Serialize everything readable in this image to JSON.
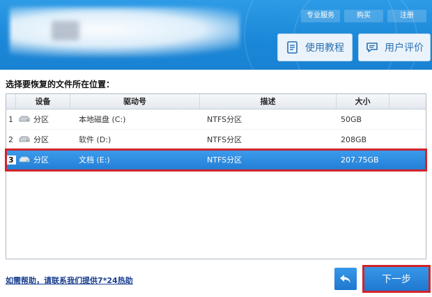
{
  "header": {
    "top_links": [
      "专业服务",
      "购买",
      "注册"
    ],
    "tutorial_label": "使用教程",
    "reviews_label": "用户评价"
  },
  "instruction": "选择要恢复的文件所在位置：",
  "table": {
    "columns": [
      "",
      "设备",
      "驱动号",
      "描述",
      "大小"
    ],
    "rows": [
      {
        "index": "1",
        "device": "分区",
        "drive": "本地磁盘 (C:)",
        "desc": "NTFS分区",
        "size": "50GB",
        "selected": false
      },
      {
        "index": "2",
        "device": "分区",
        "drive": "软件 (D:)",
        "desc": "NTFS分区",
        "size": "208GB",
        "selected": false
      },
      {
        "index": "3",
        "device": "分区",
        "drive": "文档 (E:)",
        "desc": "NTFS分区",
        "size": "207.75GB",
        "selected": true
      }
    ]
  },
  "footer": {
    "help_text": "如需帮助，请联系我们提供7*24热助",
    "next_label": "下一步"
  },
  "icons": {
    "tutorial": "book-icon",
    "reviews": "chat-icon",
    "back": "return-arrow-icon",
    "disk": "disk-icon"
  },
  "colors": {
    "header_blue": "#1b87d8",
    "selection_blue": "#237fd6",
    "highlight_red": "#d2232a",
    "link_blue": "#1a3f8f"
  }
}
